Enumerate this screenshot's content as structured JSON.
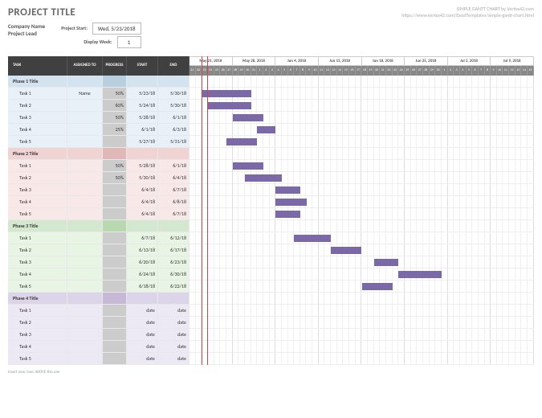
{
  "header": {
    "title": "PROJECT TITLE",
    "attribution1": "SIMPLE GANTT CHART by Vertex42.com",
    "attribution2": "https://www.vertex42.com/ExcelTemplates/simple-gantt-chart.html",
    "company": "Company Name",
    "lead": "Project Lead",
    "project_start_lbl": "Project Start:",
    "project_start": "Wed, 5/23/2018",
    "display_week_lbl": "Display Week:",
    "display_week": "1"
  },
  "columns": {
    "task": "TASK",
    "assigned": "ASSIGNED TO",
    "progress": "PROGRESS",
    "start": "START",
    "end": "END"
  },
  "weeks": [
    "May 21, 2018",
    "May 28, 2018",
    "Jun 4, 2018",
    "Jun 11, 2018",
    "Jun 18, 2018",
    "Jun 25, 2018",
    "Jul 2, 2018",
    "Jul 9, 2018"
  ],
  "days": [
    "21",
    "22",
    "23",
    "24",
    "25",
    "26",
    "27",
    "28",
    "29",
    "30",
    "31",
    "1",
    "2",
    "3",
    "4",
    "5",
    "6",
    "7",
    "8",
    "9",
    "10",
    "11",
    "12",
    "13",
    "14",
    "15",
    "16",
    "17",
    "18",
    "19",
    "20",
    "21",
    "22",
    "23",
    "24",
    "25",
    "26",
    "27",
    "28",
    "29",
    "30",
    "1",
    "2",
    "3",
    "4",
    "5",
    "6",
    "7",
    "8",
    "9",
    "10",
    "11",
    "12",
    "13",
    "14",
    "15"
  ],
  "footer": "Insert new rows ABOVE this one",
  "chart_data": {
    "type": "gantt",
    "title": "PROJECT TITLE",
    "start_date": "2018-05-21",
    "today_index": 2,
    "phases": [
      {
        "name": "Phase 1 Title",
        "color": "#d4e3f0",
        "tasks": [
          {
            "name": "Task 1",
            "assigned": "Name",
            "progress": 50,
            "start": "5/23/18",
            "end": "5/30/18",
            "bar_start": 2,
            "bar_len": 8
          },
          {
            "name": "Task 2",
            "assigned": "",
            "progress": 60,
            "start": "5/24/18",
            "end": "5/30/18",
            "bar_start": 3,
            "bar_len": 7
          },
          {
            "name": "Task 3",
            "assigned": "",
            "progress": 50,
            "start": "5/28/18",
            "end": "6/1/18",
            "bar_start": 7,
            "bar_len": 5
          },
          {
            "name": "Task 4",
            "assigned": "",
            "progress": 25,
            "start": "6/1/18",
            "end": "6/3/18",
            "bar_start": 11,
            "bar_len": 3
          },
          {
            "name": "Task 5",
            "assigned": "",
            "progress": null,
            "start": "5/27/18",
            "end": "5/31/18",
            "bar_start": 6,
            "bar_len": 5
          }
        ]
      },
      {
        "name": "Phase 2 Title",
        "color": "#f0d4d4",
        "tasks": [
          {
            "name": "Task 1",
            "assigned": "",
            "progress": 50,
            "start": "5/28/18",
            "end": "6/1/18",
            "bar_start": 7,
            "bar_len": 5
          },
          {
            "name": "Task 2",
            "assigned": "",
            "progress": 50,
            "start": "5/30/18",
            "end": "6/4/18",
            "bar_start": 9,
            "bar_len": 6
          },
          {
            "name": "Task 3",
            "assigned": "",
            "progress": null,
            "start": "6/4/18",
            "end": "6/7/18",
            "bar_start": 14,
            "bar_len": 4
          },
          {
            "name": "Task 4",
            "assigned": "",
            "progress": null,
            "start": "6/4/18",
            "end": "6/8/18",
            "bar_start": 14,
            "bar_len": 5
          },
          {
            "name": "Task 5",
            "assigned": "",
            "progress": null,
            "start": "6/4/18",
            "end": "6/7/18",
            "bar_start": 14,
            "bar_len": 4
          }
        ]
      },
      {
        "name": "Phase 3 Title",
        "color": "#d4e8d0",
        "tasks": [
          {
            "name": "Task 1",
            "assigned": "",
            "progress": null,
            "start": "6/7/18",
            "end": "6/12/18",
            "bar_start": 17,
            "bar_len": 6
          },
          {
            "name": "Task 2",
            "assigned": "",
            "progress": null,
            "start": "6/13/18",
            "end": "6/17/18",
            "bar_start": 23,
            "bar_len": 5
          },
          {
            "name": "Task 3",
            "assigned": "",
            "progress": null,
            "start": "6/20/18",
            "end": "6/23/18",
            "bar_start": 30,
            "bar_len": 4
          },
          {
            "name": "Task 4",
            "assigned": "",
            "progress": null,
            "start": "6/24/18",
            "end": "6/30/18",
            "bar_start": 34,
            "bar_len": 7
          },
          {
            "name": "Task 5",
            "assigned": "",
            "progress": null,
            "start": "6/18/18",
            "end": "6/22/18",
            "bar_start": 28,
            "bar_len": 5
          }
        ]
      },
      {
        "name": "Phase 4 Title",
        "color": "#dcd4e8",
        "tasks": [
          {
            "name": "Task 1",
            "assigned": "",
            "progress": null,
            "start": "date",
            "end": "date",
            "bar_start": null,
            "bar_len": null
          },
          {
            "name": "Task 2",
            "assigned": "",
            "progress": null,
            "start": "date",
            "end": "date",
            "bar_start": null,
            "bar_len": null
          },
          {
            "name": "Task 3",
            "assigned": "",
            "progress": null,
            "start": "date",
            "end": "date",
            "bar_start": null,
            "bar_len": null
          },
          {
            "name": "Task 4",
            "assigned": "",
            "progress": null,
            "start": "date",
            "end": "date",
            "bar_start": null,
            "bar_len": null
          },
          {
            "name": "Task 5",
            "assigned": "",
            "progress": null,
            "start": "date",
            "end": "date",
            "bar_start": null,
            "bar_len": null
          }
        ]
      }
    ]
  }
}
